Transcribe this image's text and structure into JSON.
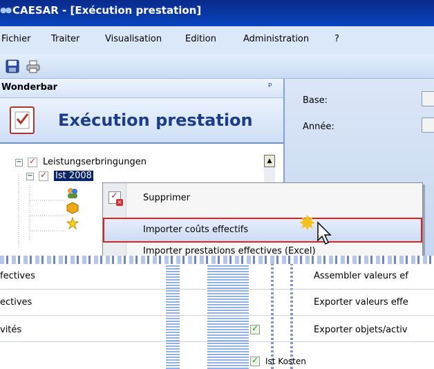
{
  "window": {
    "title": "CAESAR - [Exécution prestation]"
  },
  "menubar": {
    "items": [
      "Fichier",
      "Traiter",
      "Visualisation",
      "Edition",
      "Administration",
      "?"
    ]
  },
  "toolbar": {
    "icons": [
      "save-icon",
      "print-icon"
    ]
  },
  "wonderbar": {
    "header": "Wonderbar",
    "pin_glyph": "ᵖ",
    "banner_title": "Exécution prestation",
    "tree": {
      "root": "Leistungserbringungen",
      "child": "Ist 2008"
    }
  },
  "form": {
    "base_label": "Base:",
    "annee_label": "Année:"
  },
  "context_menu": {
    "items": [
      {
        "label": "Supprimer",
        "highlighted": false
      },
      {
        "label": "Importer coûts effectifs",
        "highlighted": true
      },
      {
        "label": "Importer prestations effectives (Excel)",
        "highlighted": false
      }
    ],
    "highlight_border_color": "#e2201d"
  },
  "lower_panel": {
    "left_texts": [
      "fectives",
      "ectives",
      "vités"
    ],
    "right_texts": [
      "Assembler valeurs ef",
      "Exporter valeurs effe",
      "Exporter objets/activ"
    ],
    "bottom_text": "Ist Kosten"
  }
}
